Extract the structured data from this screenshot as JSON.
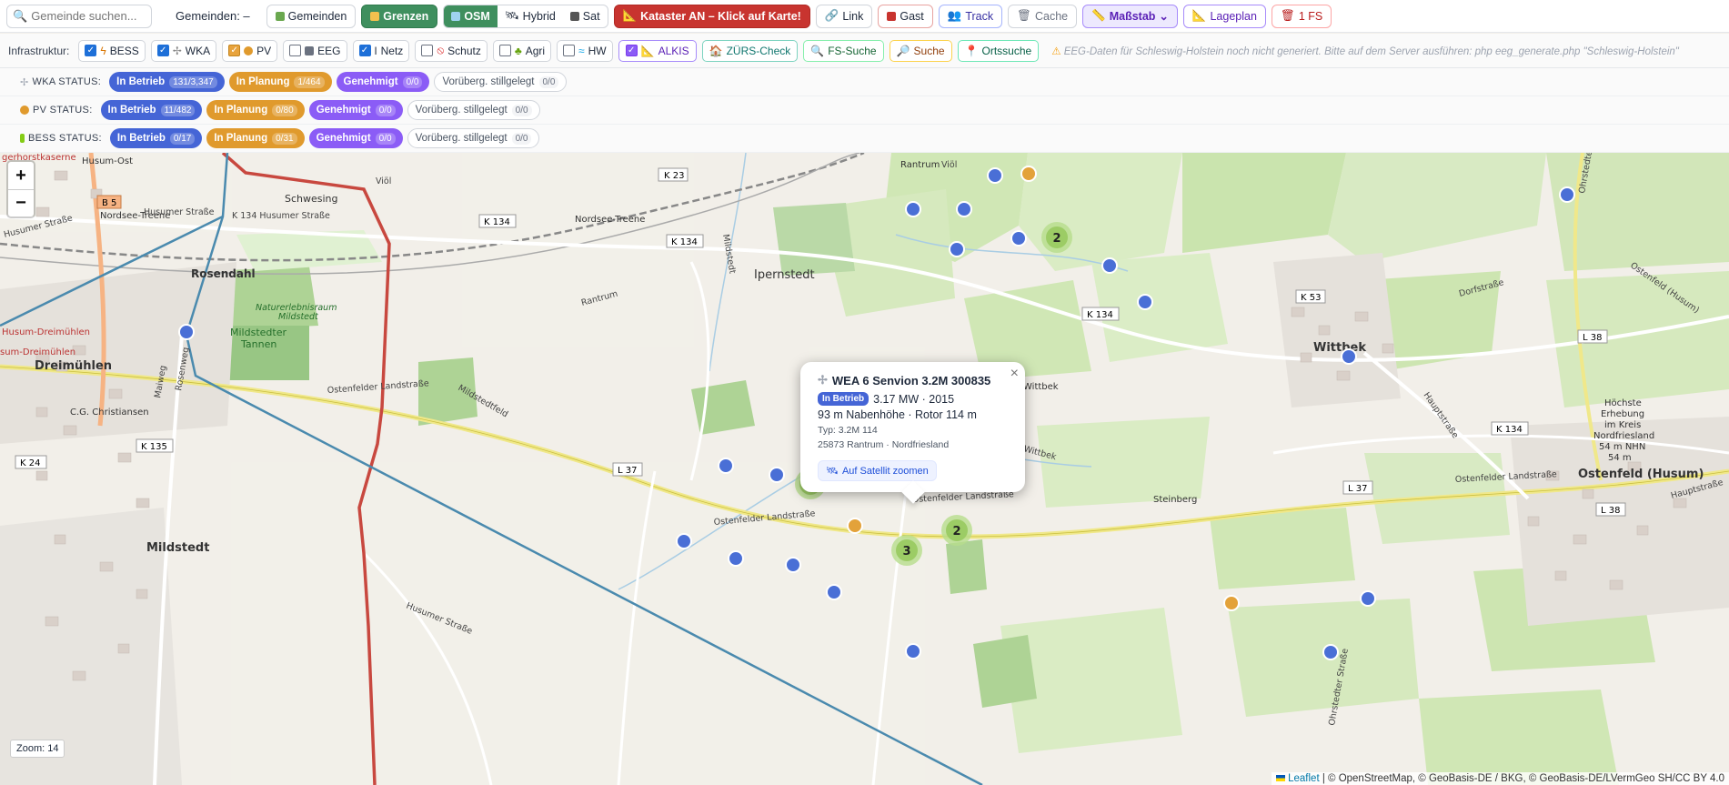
{
  "toolbar": {
    "search_placeholder": "Gemeinde suchen...",
    "gemeinden_label": "Gemeinden: –",
    "btn_gemeinden": "Gemeinden",
    "btn_grenzen": "Grenzen",
    "layer_osm": "OSM",
    "layer_hybrid": "Hybrid",
    "layer_sat": "Sat",
    "btn_kataster": "Kataster AN – Klick auf Karte!",
    "btn_link": "Link",
    "btn_gast": "Gast",
    "btn_track": "Track",
    "btn_cache": "Cache",
    "btn_massstab": "Maßstab",
    "btn_lageplan": "Lageplan",
    "btn_fs": "1 FS"
  },
  "infra": {
    "label": "Infrastruktur:",
    "items": [
      {
        "label": "BESS",
        "checked": true
      },
      {
        "label": "WKA",
        "checked": true
      },
      {
        "label": "PV",
        "checked": true
      },
      {
        "label": "EEG",
        "checked": false
      },
      {
        "label": "Netz",
        "checked": true
      },
      {
        "label": "Schutz",
        "checked": false
      },
      {
        "label": "Agri",
        "checked": false
      },
      {
        "label": "HW",
        "checked": false
      }
    ],
    "alkis": "ALKIS",
    "alkis_checked": true,
    "zuers": "ZÜRS-Check",
    "fs_suche": "FS-Suche",
    "suche": "Suche",
    "ortssuche": "Ortssuche",
    "warning": "EEG-Daten für Schleswig-Holstein noch nicht generiert. Bitte auf dem Server ausführen: php eeg_generate.php \"Schleswig-Holstein\""
  },
  "status_rows": [
    {
      "label": "WKA STATUS:",
      "betrieb": "131/3,347",
      "planung": "1/464",
      "genehmigt": "0/0",
      "stillgelegt": "0/0"
    },
    {
      "label": "PV STATUS:",
      "betrieb": "11/482",
      "planung": "0/80",
      "genehmigt": "0/0",
      "stillgelegt": "0/0"
    },
    {
      "label": "BESS STATUS:",
      "betrieb": "0/17",
      "planung": "0/31",
      "genehmigt": "0/0",
      "stillgelegt": "0/0"
    }
  ],
  "status_names": {
    "betrieb": "In Betrieb",
    "planung": "In Planung",
    "genehmigt": "Genehmigt",
    "stillgelegt": "Vorüberg. stillgelegt"
  },
  "popup": {
    "title": "WEA 6 Senvion 3.2M 300835",
    "status": "In Betrieb",
    "power_year": "3.17 MW · 2015",
    "dims": "93 m Nabenhöhe · Rotor 114 m",
    "typ": "Typ: 3.2M 114",
    "location": "25873 Rantrum · Nordfriesland",
    "zoom_link": "Auf Satellit zoomen"
  },
  "map": {
    "zoom_level": "Zoom: 14",
    "attribution_leaflet": "Leaflet",
    "attribution_rest": "| © OpenStreetMap, © GeoBasis-DE / BKG, © GeoBasis-DE/LVermGeo SH/CC BY 4.0",
    "places": {
      "husum_kaserne": "gerhorstkaserne",
      "husum_ost": "Husum-Ost",
      "schwesing": "Schwesing",
      "viol": "Viöl",
      "nordsee_treene": "Nordsee-Treene",
      "nordsee_treene2": "Nordsee-Treene",
      "rosendahl": "Rosendahl",
      "naturerlebnis": "Naturerlebnisraum",
      "mildstedt_small": "Mildstedt",
      "mildstedter_tannen": "Mildstedter",
      "tannen": "Tannen",
      "husum_dreimuehlen": "Husum-Dreimühlen",
      "husum_dreimuehlen2": "sum-Dreimühlen",
      "dreimuehlen": "Dreimühlen",
      "cg_christiansen": "C.G. Christiansen",
      "mildstedt": "Mildstedt",
      "ipernstedt": "Ipernstedt",
      "rantrum": "Rantrum",
      "rantrum2": "Rantrum",
      "wittbek": "Wittbek",
      "wittbek2": "Wittbek",
      "ostenfeld": "Ostenfeld (Husum)",
      "steinberg": "Steinberg",
      "highest": "Höchste",
      "highest2": "Erhebung",
      "highest3": "im Kreis",
      "highest4": "Nordfriesland",
      "highest5": "54 m NHN",
      "highest6": "54 m",
      "mildstedt_r": "Mildstedt",
      "mildstedt_rd": "Mildstedt",
      "viol_r": "Viöl"
    },
    "roads": {
      "b5": "B 5",
      "k23": "K 23",
      "k134a": "K 134",
      "k134b": "K 134",
      "k134c": "K 134",
      "k134d": "K 134",
      "k134e": "K 134",
      "k135": "K 135",
      "k24": "K 24",
      "k53": "K 53",
      "l37a": "L 37",
      "l37b": "L 37",
      "l38a": "L 38",
      "l38b": "L 38",
      "husumer1": "Husumer Straße",
      "husumer2": "Husumer Straße",
      "husumer3": "Husumer Straße",
      "husumer4": "Husumer Straße",
      "k134h": "K 134 Husumer Straße",
      "ostenfelder1": "Ostenfelder Landstraße",
      "ostenfelder2": "Ostenfelder Landstraße",
      "ostenfelder3": "Ostenfelder Landstraße",
      "ostenfelder4": "Ostenfelder Landstraße",
      "dorfstrasse": "Dorfstraße",
      "hauptstrasse1": "Hauptstraße",
      "hauptstrasse2": "Hauptstraße",
      "ohrstedter1": "Ohrstedter Straße",
      "ohrstedter2": "Ohrstedter Straße",
      "ostenfeld_husum": "Ostenfeld (Husum)",
      "wittbek_r": "Wittbek",
      "mildstedtfeld": "Mildstedtfeld",
      "maiweg": "Maiweg",
      "rosenweg": "Rosenweg",
      "husumer_s": "Husumer Straße",
      "wittbek_s": "Wittbek"
    },
    "cluster_counts": [
      "2",
      "2",
      "2",
      "3",
      "2"
    ]
  },
  "colors": {
    "wka_marker": "#4a6fd6",
    "pv_marker": "#e3a23a",
    "cluster": "#9ccc65",
    "border_red": "#c8483f",
    "border_blue": "#4a8aae"
  }
}
